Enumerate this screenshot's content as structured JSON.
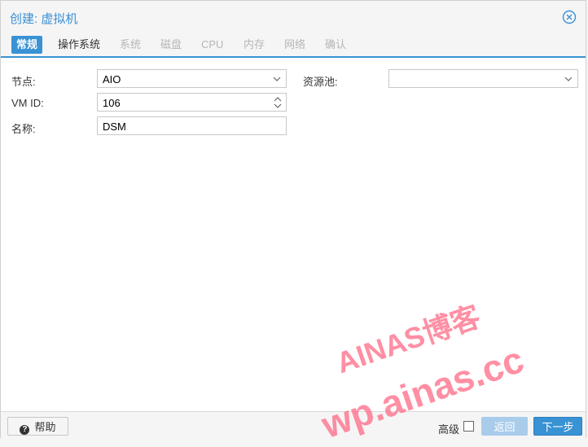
{
  "dialog": {
    "title": "创建: 虚拟机"
  },
  "tabs": [
    {
      "label": "常规",
      "state": "active"
    },
    {
      "label": "操作系统",
      "state": "enabled"
    },
    {
      "label": "系统",
      "state": "disabled"
    },
    {
      "label": "磁盘",
      "state": "disabled"
    },
    {
      "label": "CPU",
      "state": "disabled"
    },
    {
      "label": "内存",
      "state": "disabled"
    },
    {
      "label": "网络",
      "state": "disabled"
    },
    {
      "label": "确认",
      "state": "disabled"
    }
  ],
  "form": {
    "node_label": "节点:",
    "node_value": "AIO",
    "vmid_label": "VM ID:",
    "vmid_value": "106",
    "name_label": "名称:",
    "name_value": "DSM",
    "pool_label": "资源池:",
    "pool_value": ""
  },
  "watermark": {
    "line1": "AINAS博客",
    "line2": "wp.ainas.cc"
  },
  "footer": {
    "help_label": "帮助",
    "advanced_label": "高级",
    "advanced_checked": false,
    "back_label": "返回",
    "next_label": "下一步"
  },
  "colors": {
    "accent": "#3892d4",
    "watermark": "#ff6a86"
  }
}
